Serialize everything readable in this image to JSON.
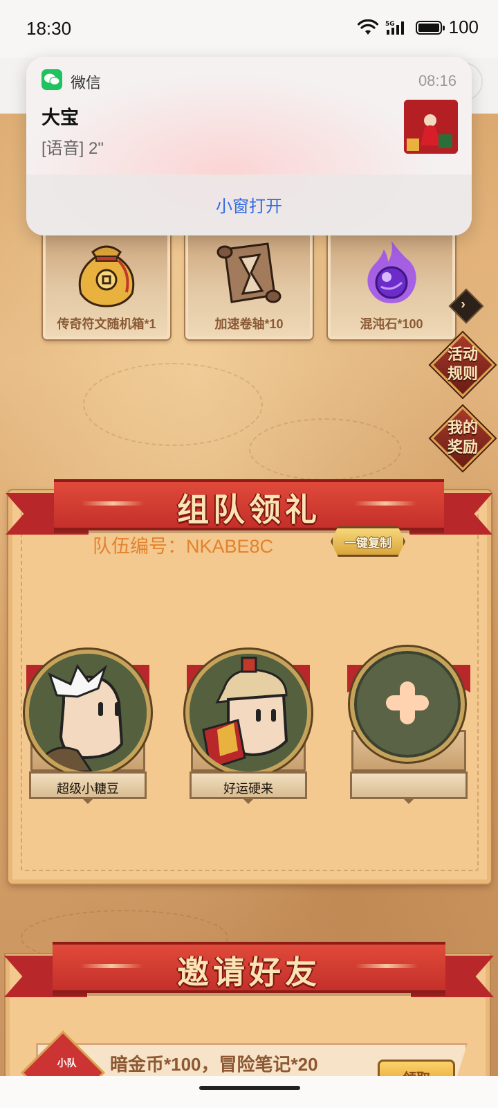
{
  "status_bar": {
    "time": "18:30",
    "battery": "100",
    "icons": [
      "wifi-icon",
      "5g-signal-icon",
      "battery-icon"
    ]
  },
  "notification": {
    "app_name": "微信",
    "time": "08:16",
    "sender": "大宝",
    "message": "[语音] 2\"",
    "action": "小窗打开",
    "accent": "#1ec25f",
    "action_color": "#2f6ae0"
  },
  "rewards": [
    {
      "label": "传奇符文随机箱*1",
      "icon": "coin-bag-icon"
    },
    {
      "label": "加速卷轴*10",
      "icon": "hourglass-scroll-icon"
    },
    {
      "label": "混沌石*100",
      "icon": "chaos-stone-icon"
    }
  ],
  "side_buttons": {
    "rules": "活动规则",
    "my_rewards": "我的奖励"
  },
  "team_section": {
    "title": "组队领礼",
    "team_no": "队伍编号：NKABE8C",
    "copy_label": "一键复制",
    "members": [
      {
        "name": "超级小糖豆"
      },
      {
        "name": "好运硬来"
      }
    ]
  },
  "invite_section": {
    "title": "邀请好友",
    "small_team_badge": "小队",
    "reward_text": "暗金币*100，冒险笔记*20",
    "claim_label": "领取"
  }
}
